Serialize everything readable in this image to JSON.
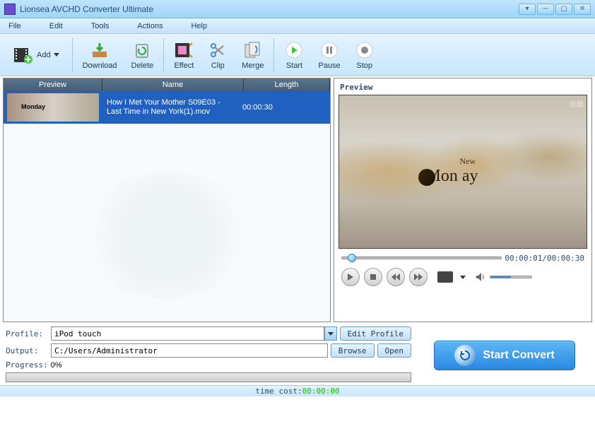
{
  "app": {
    "title": "Lionsea AVCHD Converter Ultimate"
  },
  "menu": [
    "File",
    "Edit",
    "Tools",
    "Actions",
    "Help"
  ],
  "toolbar": {
    "add": "Add",
    "download": "Download",
    "delete": "Delete",
    "effect": "Effect",
    "clip": "Clip",
    "merge": "Merge",
    "start": "Start",
    "pause": "Pause",
    "stop": "Stop"
  },
  "list": {
    "cols": {
      "preview": "Preview",
      "name": "Name",
      "length": "Length"
    },
    "items": [
      {
        "name": "How I Met Your Mother S09E03 - Last Time in New York(1).mov",
        "length": "00:00:30"
      }
    ]
  },
  "preview": {
    "title": "Preview",
    "overlay_small": "New",
    "overlay_big": "Mon   ay",
    "watermark": "优酷",
    "time": "00:00:01/00:00:30"
  },
  "settings": {
    "profile_label": "Profile:",
    "profile_value": "iPod touch",
    "edit_profile": "Edit Profile",
    "output_label": "Output:",
    "output_value": "C:/Users/Administrator",
    "browse": "Browse",
    "open": "Open",
    "progress_label": "Progress:",
    "progress_value": "0%"
  },
  "convert_label": "Start Convert",
  "timecost_label": "time cost:",
  "timecost_value": "00:00:00"
}
